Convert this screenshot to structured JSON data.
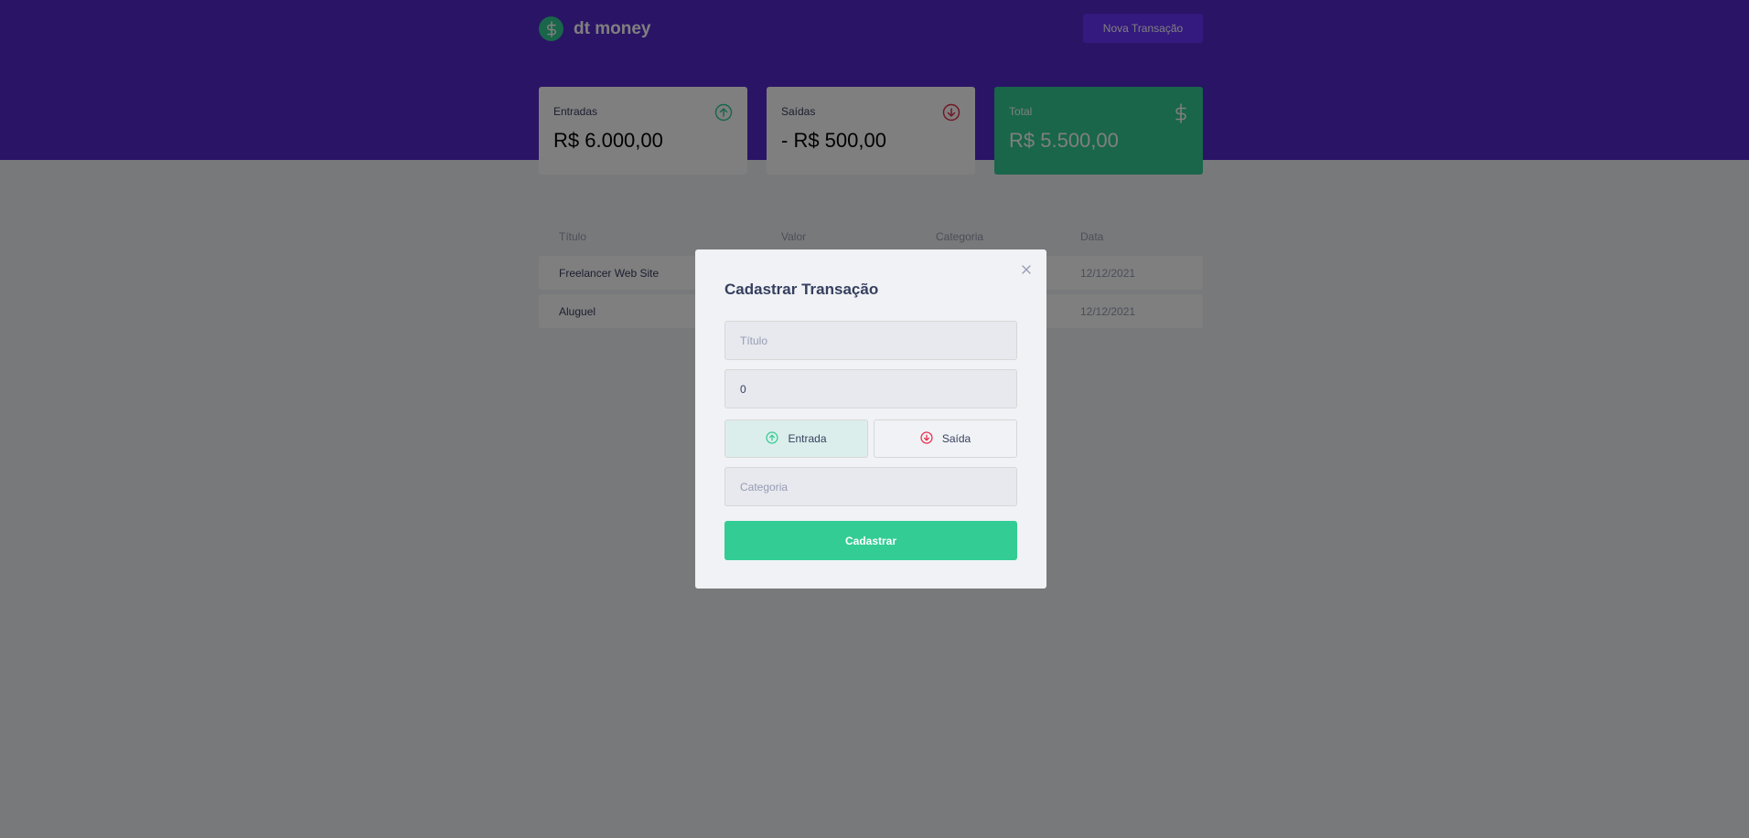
{
  "header": {
    "app_name": "dt money",
    "new_transaction_label": "Nova Transação"
  },
  "summary": {
    "income": {
      "label": "Entradas",
      "value": "R$ 6.000,00"
    },
    "outcome": {
      "label": "Saídas",
      "value": "- R$ 500,00"
    },
    "total": {
      "label": "Total",
      "value": "R$ 5.500,00"
    }
  },
  "table": {
    "columns": [
      "Título",
      "Valor",
      "Categoria",
      "Data"
    ],
    "rows": [
      {
        "title": "Freelancer Web Site",
        "date": "12/12/2021"
      },
      {
        "title": "Aluguel",
        "date": "12/12/2021"
      }
    ]
  },
  "modal": {
    "title": "Cadastrar Transação",
    "title_placeholder": "Título",
    "amount_value": "0",
    "deposit_label": "Entrada",
    "withdraw_label": "Saída",
    "category_placeholder": "Categoria",
    "submit_label": "Cadastrar"
  },
  "colors": {
    "brand": "#5429cc",
    "green": "#33cc95",
    "red": "#e52e4d",
    "text": "#363f5f",
    "muted": "#969cb3"
  }
}
